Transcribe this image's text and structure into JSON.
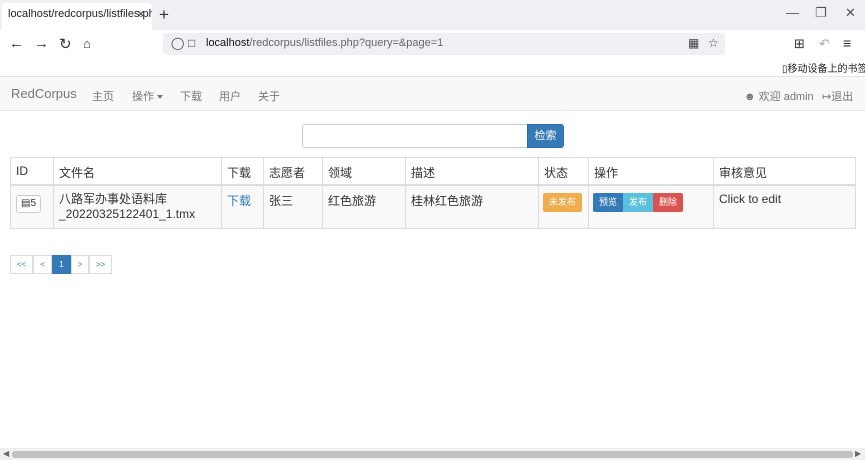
{
  "browser": {
    "tab_title": "localhost/redcorpus/listfiles.php",
    "tab_close": "×",
    "new_tab": "+",
    "url_host": "localhost",
    "url_path": "/redcorpus/listfiles.php?query=&page=1",
    "mobile_bookmarks": "移动设备上的书签"
  },
  "app_nav": {
    "brand": "RedCorpus",
    "items": [
      "主页",
      "操作",
      "下载",
      "用户",
      "关于"
    ],
    "welcome": "欢迎 admin",
    "logout": "退出"
  },
  "search": {
    "placeholder": "",
    "button": "检索"
  },
  "table": {
    "headers": [
      "ID",
      "文件名",
      "下载",
      "志愿者",
      "领域",
      "描述",
      "状态",
      "操作",
      "审核意见"
    ],
    "rows": [
      {
        "id": "5",
        "filename_line1": "八路军办事处语料库",
        "filename_line2": "_20220325122401_1.tmx",
        "download": "下载",
        "volunteer": "张三",
        "domain": "红色旅游",
        "description": "桂林红色旅游",
        "status": "未发布",
        "actions": [
          "预览",
          "发布",
          "删除"
        ],
        "review": "Click to edit"
      }
    ]
  },
  "pagination": {
    "first": "<<",
    "prev": "<",
    "current": "1",
    "next": ">",
    "last": ">>"
  },
  "colors": {
    "primary": "#337ab7",
    "info": "#5bc0de",
    "danger": "#d9534f",
    "warning": "#f0ad4e"
  }
}
